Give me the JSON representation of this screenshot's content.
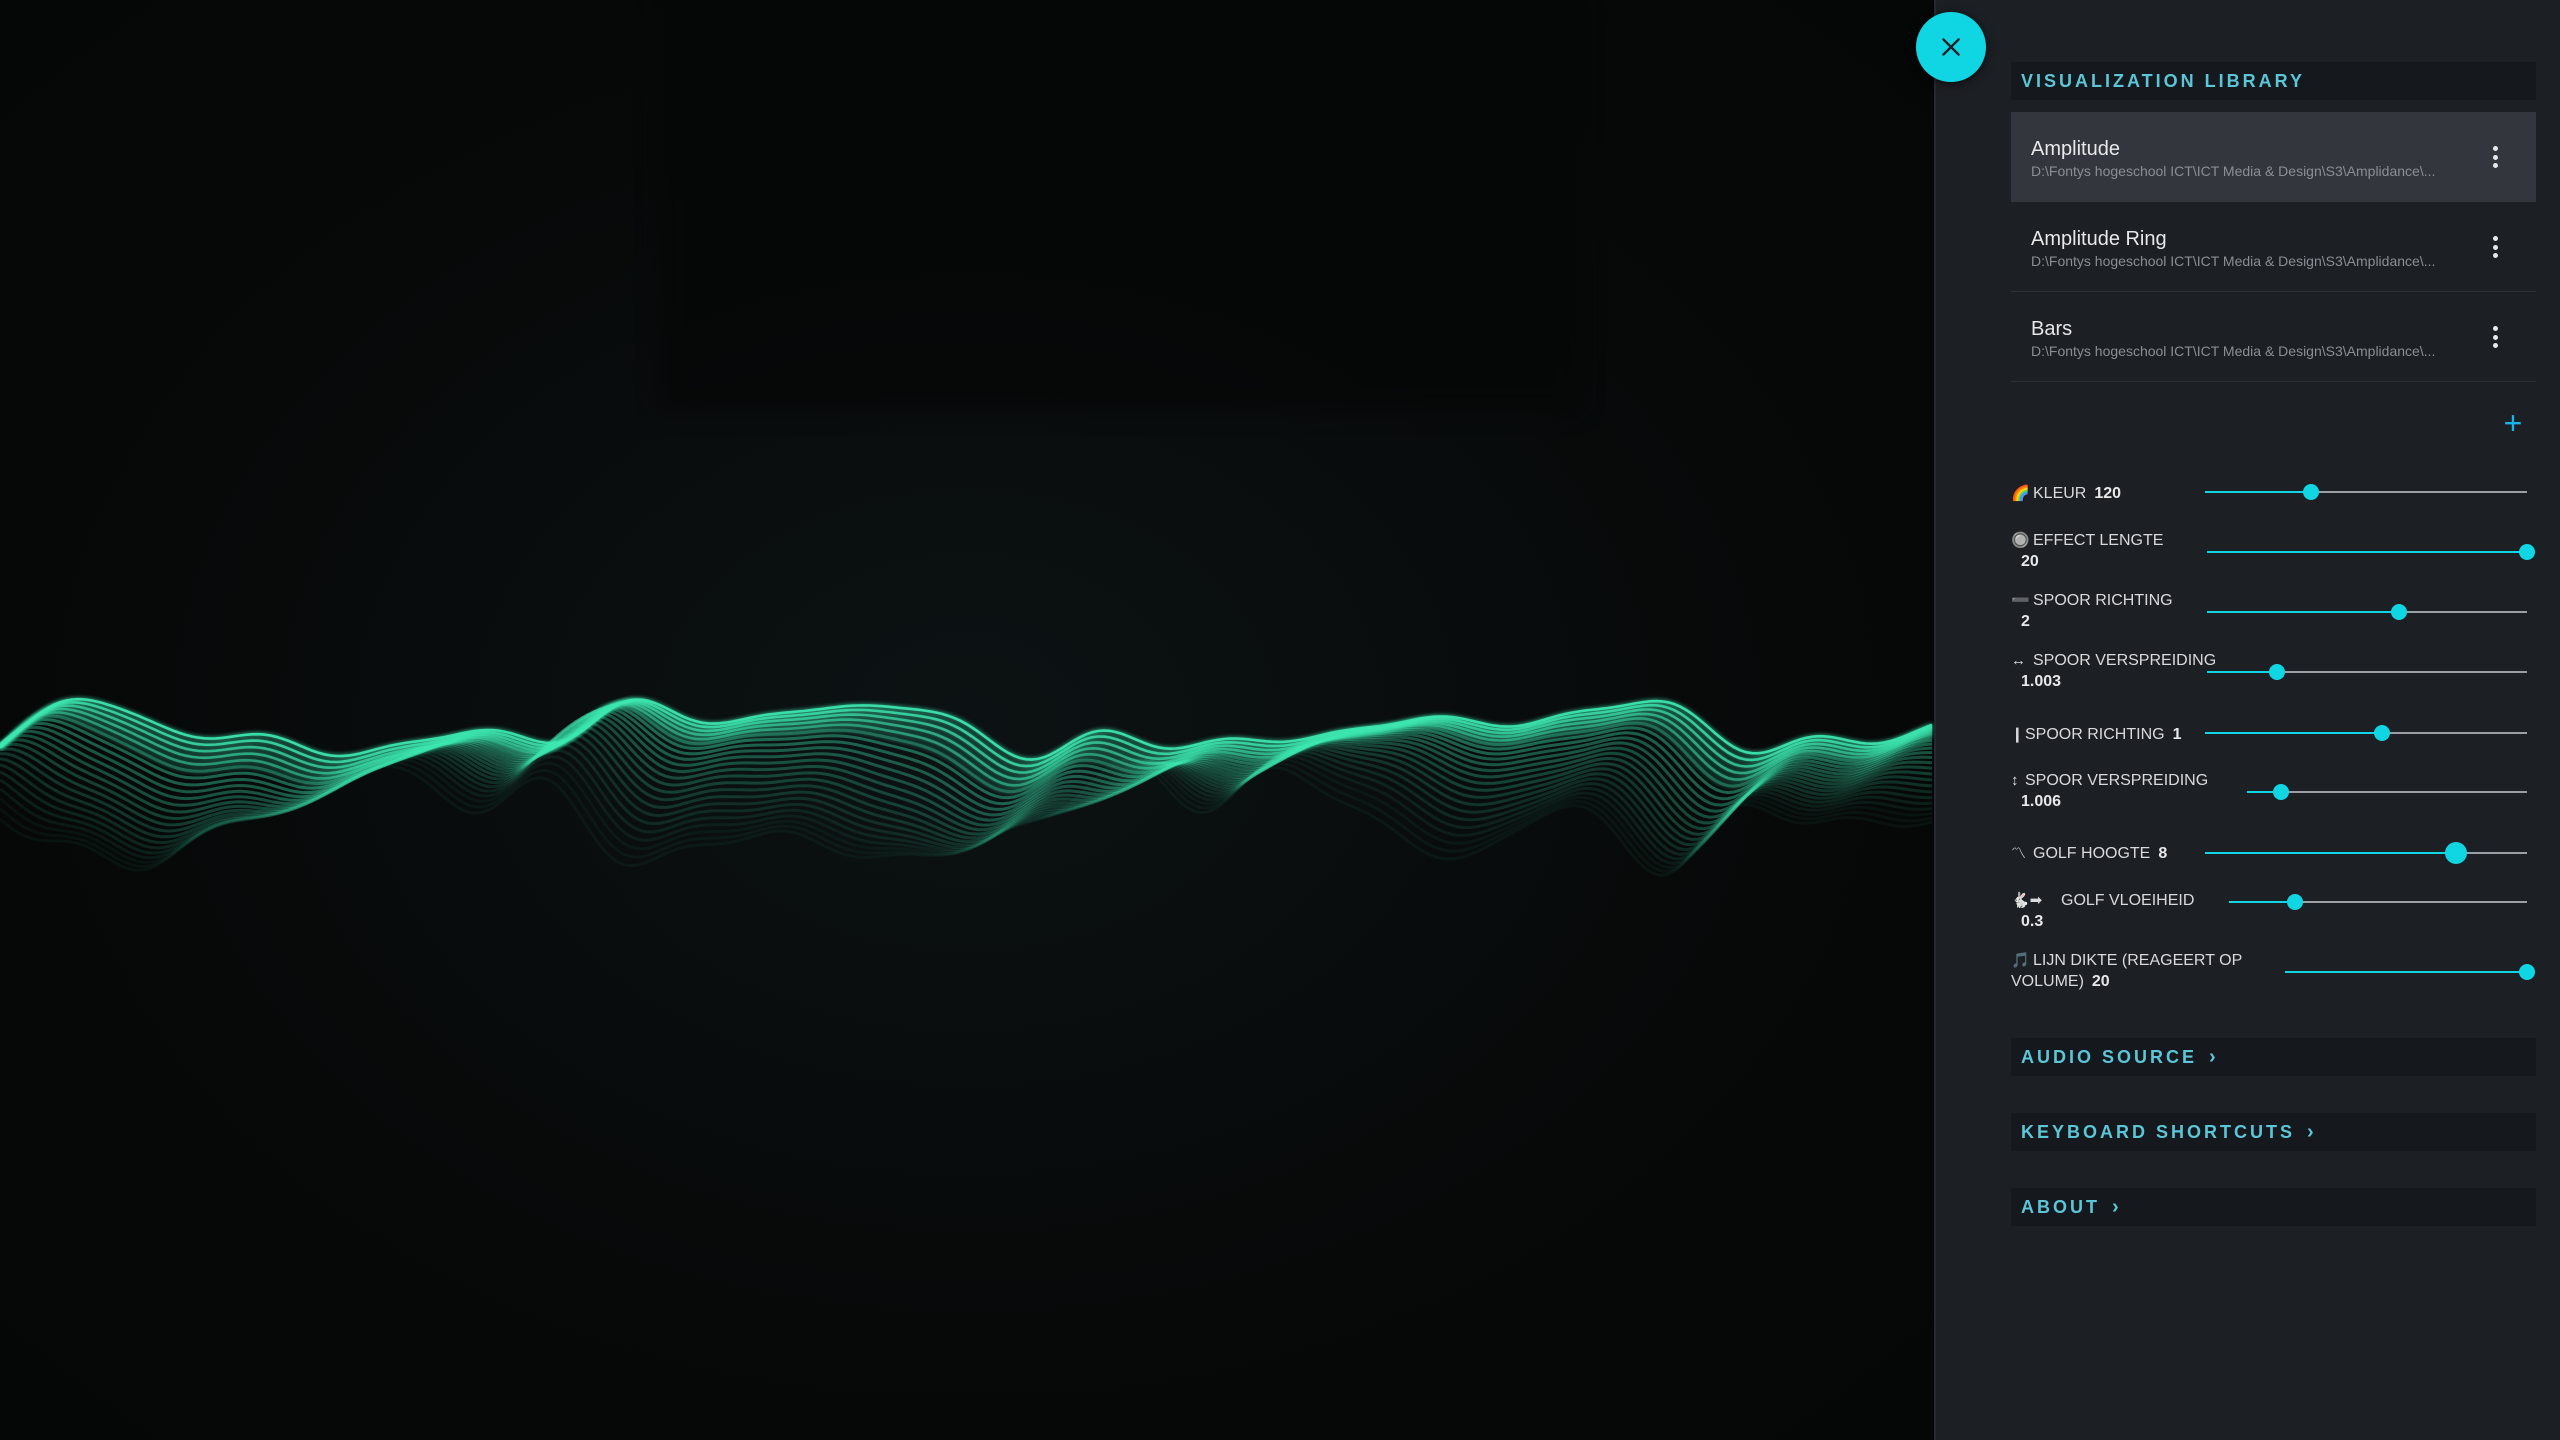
{
  "close_button": {
    "icon": "close-icon"
  },
  "library": {
    "title": "VISUALIZATION LIBRARY",
    "items": [
      {
        "name": "Amplitude",
        "path": "D:\\Fontys hogeschool ICT\\ICT Media & Design\\S3\\Amplidance\\...",
        "active": true
      },
      {
        "name": "Amplitude Ring",
        "path": "D:\\Fontys hogeschool ICT\\ICT Media & Design\\S3\\Amplidance\\...",
        "active": false
      },
      {
        "name": "Bars",
        "path": "D:\\Fontys hogeschool ICT\\ICT Media & Design\\S3\\Amplidance\\...",
        "active": false
      }
    ],
    "add_label": "+"
  },
  "controls": [
    {
      "icon": "🌈",
      "label": "KLEUR",
      "value": "120",
      "fraction": 0.33
    },
    {
      "icon": "🔘",
      "label": "EFFECT LENGTE",
      "value": "20",
      "fraction": 1.0
    },
    {
      "icon": "➖",
      "label": "SPOOR RICHTING",
      "value": "2",
      "fraction": 0.6
    },
    {
      "icon": "↔",
      "label": "SPOOR VERSPREIDING",
      "value": "1.003",
      "fraction": 0.22
    },
    {
      "icon": "❙",
      "label": "SPOOR RICHTING",
      "value": "1",
      "fraction": 0.55
    },
    {
      "icon": "↕",
      "label": "SPOOR VERSPREIDING",
      "value": "1.006",
      "fraction": 0.12
    },
    {
      "icon": "〽",
      "label": "GOLF HOOGTE",
      "value": "8",
      "fraction": 0.78
    },
    {
      "icon": "🐇➡",
      "label": "GOLF VLOEIHEID",
      "value": "0.3",
      "fraction": 0.22
    },
    {
      "icon": "🎵",
      "label": "LIJN DIKTE (REAGEERT OP VOLUME)",
      "value": "20",
      "fraction": 1.0
    }
  ],
  "sections": {
    "audio_source": "AUDIO SOURCE",
    "keyboard_shortcuts": "KEYBOARD SHORTCUTS",
    "about": "ABOUT"
  },
  "colors": {
    "accent": "#10d6e4",
    "wave": "#3de8b0",
    "panel": "#1c1f24"
  }
}
